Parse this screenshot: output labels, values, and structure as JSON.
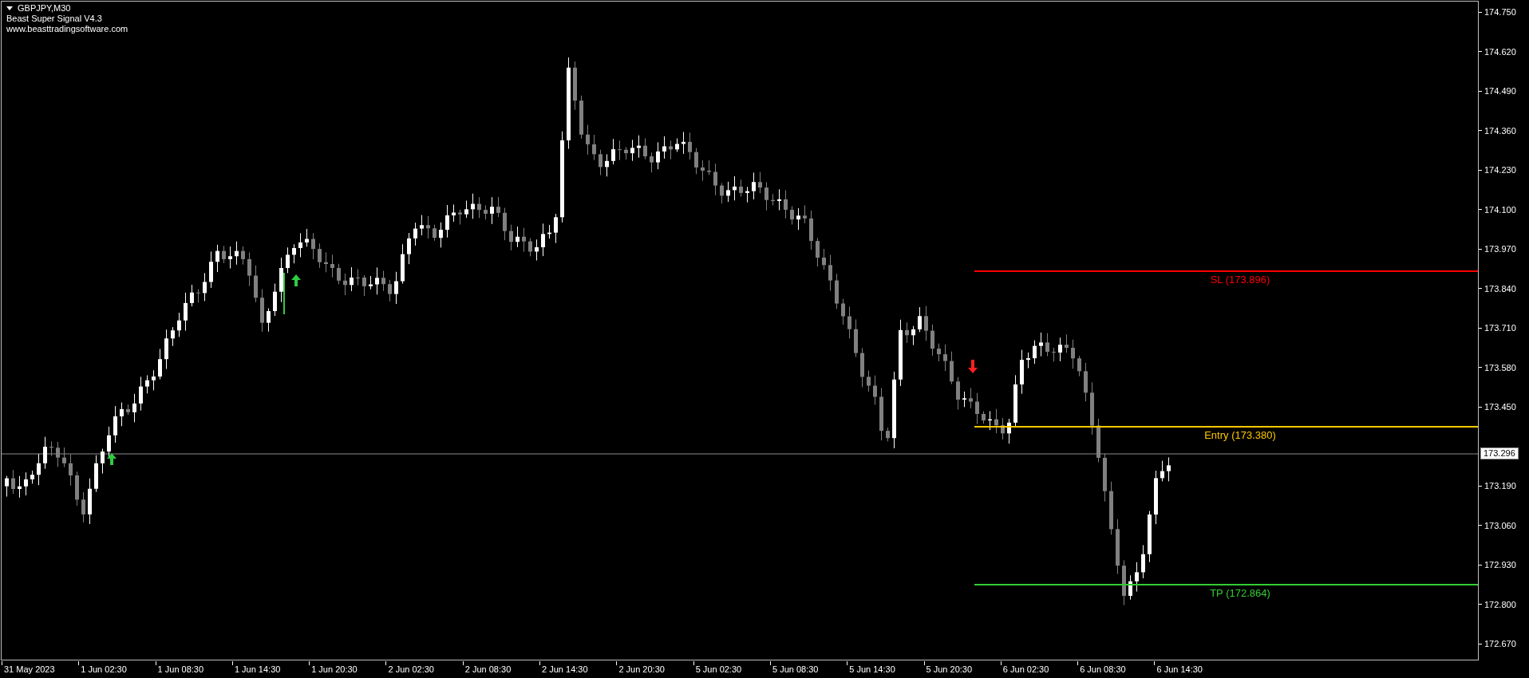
{
  "chart": {
    "symbol": "GBPJPY,M30",
    "indicator": "Beast Super Signal V4.3",
    "website": "www.beasttradingsoftware.com"
  },
  "levels": [
    {
      "label": "SL (173.896)",
      "color": "#ff0000"
    },
    {
      "label": "Entry (173.380)",
      "color": "#ffc800"
    },
    {
      "label": "TP (172.864)",
      "color": "#32cd32"
    }
  ],
  "price_axis": [
    "174.750",
    "174.620",
    "174.490",
    "174.360",
    "174.230",
    "174.100",
    "173.970",
    "173.840",
    "173.710",
    "173.580",
    "173.450",
    "173.190",
    "173.060",
    "172.930",
    "172.800",
    "172.670"
  ],
  "current_price": "173.296",
  "time_axis": [
    "31 May 2023",
    "1 Jun 02:30",
    "1 Jun 08:30",
    "1 Jun 14:30",
    "1 Jun 20:30",
    "2 Jun 02:30",
    "2 Jun 08:30",
    "2 Jun 14:30",
    "2 Jun 20:30",
    "5 Jun 02:30",
    "5 Jun 08:30",
    "5 Jun 14:30",
    "5 Jun 20:30",
    "6 Jun 02:30",
    "6 Jun 08:30",
    "6 Jun 14:30"
  ]
}
